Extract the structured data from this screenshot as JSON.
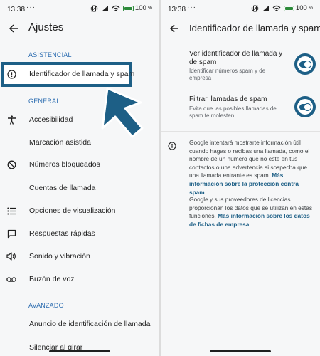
{
  "status_bar": {
    "time": "13:38",
    "dots": "···",
    "battery": "100"
  },
  "left": {
    "title": "Ajustes",
    "sections": {
      "asistencial": "ASISTENCIAL",
      "general": "GENERAL",
      "avanzado": "AVANZADO"
    },
    "items": {
      "caller_id": "Identificador de llamada y spam",
      "accessibility": "Accesibilidad",
      "assisted_dialing": "Marcación asistida",
      "blocked_numbers": "Números bloqueados",
      "calling_accounts": "Cuentas de llamada",
      "display_options": "Opciones de visualización",
      "quick_responses": "Respuestas rápidas",
      "sound_vibration": "Sonido y vibración",
      "voicemail": "Buzón de voz",
      "caller_id_announcement": "Anuncio de identificación de llamada",
      "silence_flip": "Silenciar al girar"
    },
    "accent_color": "#1d5f86"
  },
  "right": {
    "title": "Identificador de llamada y spam",
    "toggles": [
      {
        "title": "Ver identificador de llamada y de spam",
        "subtitle": "Identificar números spam y de empresa",
        "on": true
      },
      {
        "title": "Filtrar llamadas de spam",
        "subtitle": "Evita que las posibles llamadas de spam te molesten",
        "on": true
      }
    ],
    "info1_text": "Google intentará mostrarte información útil cuando hagas o recibas una llamada, como el nombre de un número que no esté en tus contactos o una advertencia si sospecha que una llamada entrante es spam. ",
    "info1_link": "Más información sobre la protección contra spam",
    "info2_text": "Google y sus proveedores de licencias proporcionan los datos que se utilizan en estas funciones. ",
    "info2_link": "Más información sobre los datos de fichas de empresa"
  }
}
